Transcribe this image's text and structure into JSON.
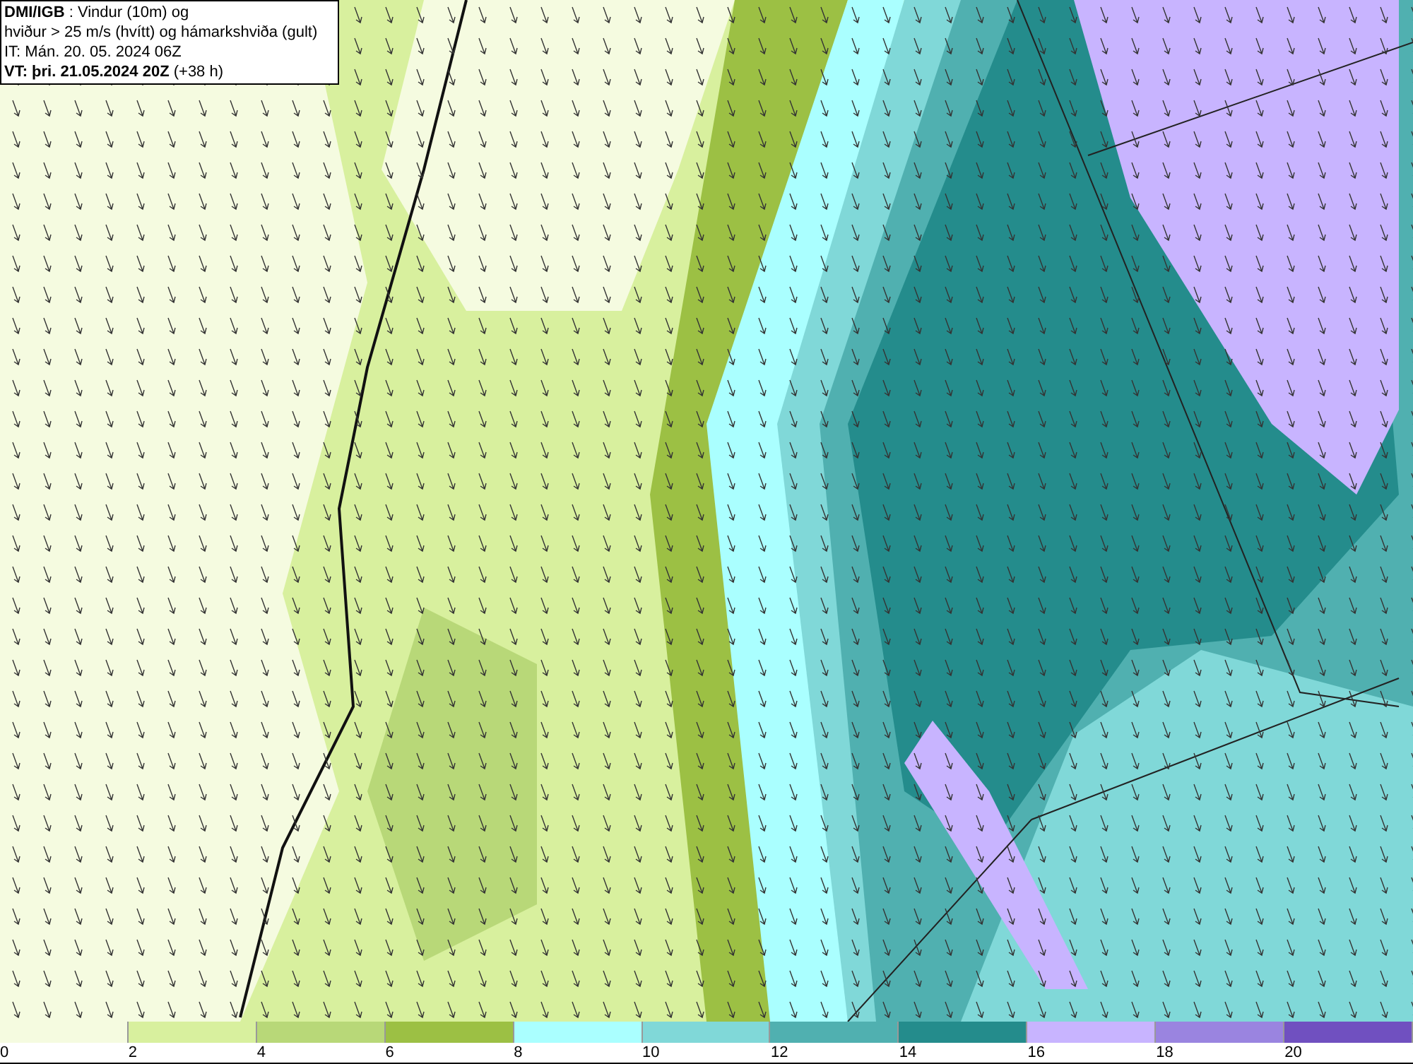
{
  "title_lines": [
    "**DMI/IGB** : Vindur (10m) og",
    "hviður > 25 m/s (hvítt) og hámarkshviða (gult)",
    "IT: Mán. 20. 05. 2024 06Z",
    "**VT: þri. 21.05.2024 20Z** (+38 h)"
  ],
  "legend": [
    {
      "label": "0",
      "color": "#f5fbe0"
    },
    {
      "label": "2",
      "color": "#d8f09e"
    },
    {
      "label": "4",
      "color": "#b8d878"
    },
    {
      "label": "6",
      "color": "#9cc044"
    },
    {
      "label": "8",
      "color": "#aaffff"
    },
    {
      "label": "10",
      "color": "#80d8d8"
    },
    {
      "label": "12",
      "color": "#50b0b0"
    },
    {
      "label": "14",
      "color": "#248c8c"
    },
    {
      "label": "16",
      "color": "#c8b4ff"
    },
    {
      "label": "18",
      "color": "#9a84e0"
    },
    {
      "label": "20",
      "color": "#7050c0"
    }
  ]
}
